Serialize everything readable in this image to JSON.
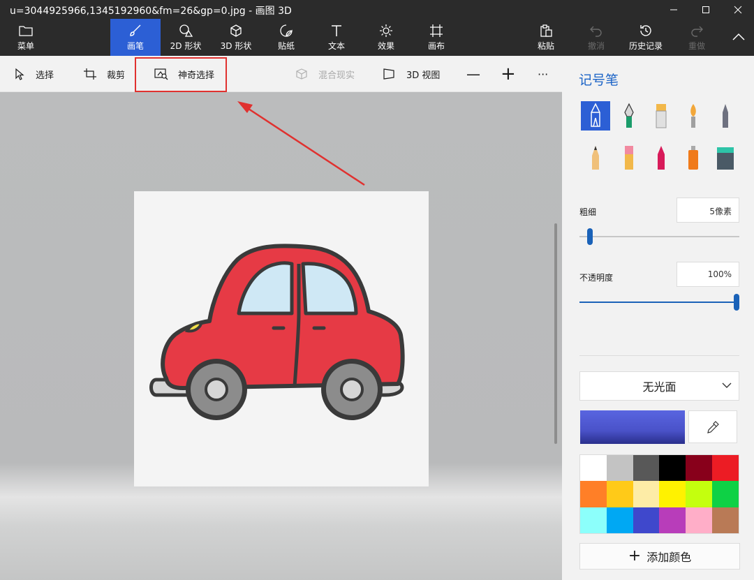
{
  "window": {
    "title": "u=3044925966,1345192960&fm=26&gp=0.jpg - 画图 3D"
  },
  "ribbon": {
    "menu": {
      "label": "菜单",
      "icon": "folder-icon"
    },
    "tabs": [
      {
        "label": "画笔",
        "icon": "brush-icon",
        "active": true
      },
      {
        "label": "2D 形状",
        "icon": "2d-shapes-icon"
      },
      {
        "label": "3D 形状",
        "icon": "3d-shapes-icon"
      },
      {
        "label": "贴纸",
        "icon": "sticker-icon"
      },
      {
        "label": "文本",
        "icon": "text-icon"
      },
      {
        "label": "效果",
        "icon": "effects-icon"
      },
      {
        "label": "画布",
        "icon": "canvas-icon"
      }
    ],
    "paste": {
      "label": "粘贴",
      "icon": "paste-icon"
    },
    "undo": {
      "label": "撤消",
      "icon": "undo-icon",
      "enabled": false
    },
    "history": {
      "label": "历史记录",
      "icon": "history-icon"
    },
    "redo": {
      "label": "重做",
      "icon": "redo-icon",
      "enabled": false
    }
  },
  "toolbar": {
    "select": {
      "label": "选择",
      "icon": "select-cursor-icon"
    },
    "crop": {
      "label": "裁剪",
      "icon": "crop-icon"
    },
    "magic_select": {
      "label": "神奇选择",
      "icon": "magic-select-icon",
      "highlighted": true
    },
    "mixed_reality": {
      "label": "混合现实",
      "icon": "mixed-reality-icon",
      "enabled": false
    },
    "view_3d": {
      "label": "3D 视图",
      "icon": "3d-view-icon"
    },
    "zoom_out": "—",
    "zoom_in": "+",
    "more": "···"
  },
  "panel": {
    "title": "记号笔",
    "tools": [
      "marker-icon",
      "calligraphy-pen-icon",
      "oil-brush-icon",
      "watercolor-icon",
      "pixel-pen-icon",
      "pencil-icon",
      "eraser-icon",
      "crayon-icon",
      "spray-can-icon",
      "fill-bucket-icon"
    ],
    "selected_tool": "marker-icon",
    "thickness": {
      "label": "粗细",
      "value": "5像素",
      "fraction": 0.05
    },
    "opacity": {
      "label": "不透明度",
      "value": "100%",
      "fraction": 1.0
    },
    "finish": {
      "label": "无光面"
    },
    "current_color": "#4a52c9",
    "palette": [
      "#ffffff",
      "#c3c3c3",
      "#585858",
      "#000000",
      "#88001b",
      "#ec1c24",
      "#ff7f27",
      "#ffca18",
      "#fdeca6",
      "#fff200",
      "#c4ff0e",
      "#0ed145",
      "#8cfffb",
      "#00a8f3",
      "#3f48cc",
      "#b83dba",
      "#ffaec8",
      "#b97a56"
    ],
    "add_color": {
      "label": "添加颜色"
    }
  },
  "colors": {
    "accent": "#2c5fd5",
    "highlight": "#e0312f",
    "ribbon_bg": "#2b2b2b",
    "panel_title": "#1c64c7"
  }
}
